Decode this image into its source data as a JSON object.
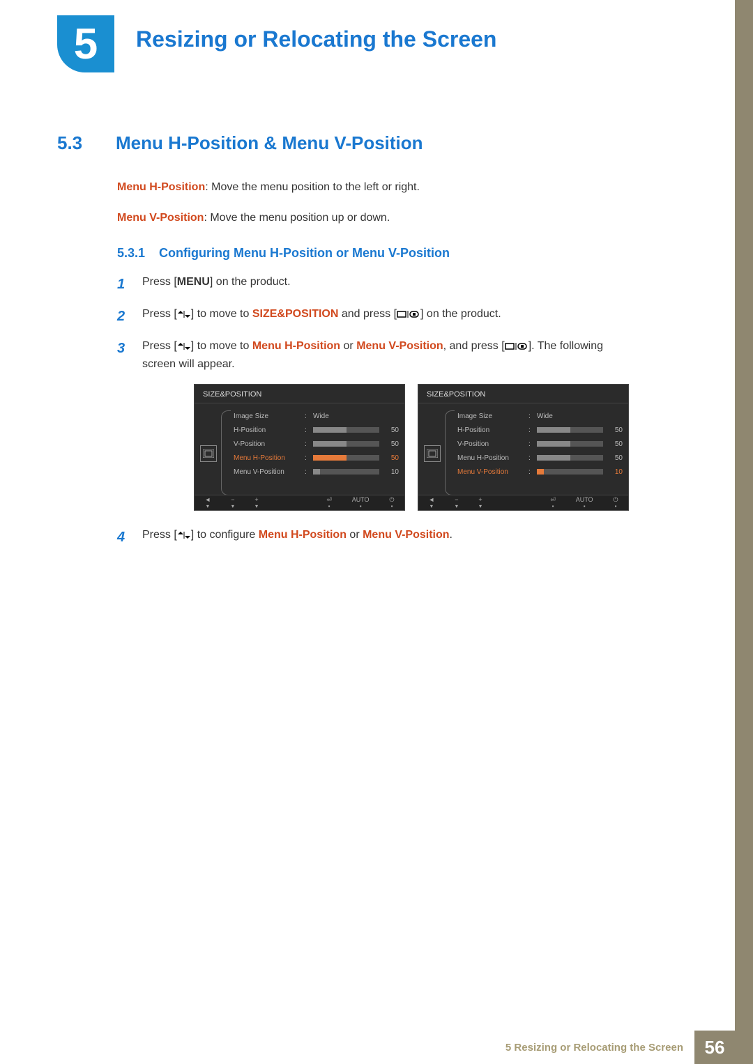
{
  "chapter": {
    "number": "5",
    "title": "Resizing or Relocating the Screen"
  },
  "section": {
    "number": "5.3",
    "title": "Menu H-Position & Menu V-Position"
  },
  "descriptions": {
    "h_label": "Menu H-Position",
    "h_text": ": Move the menu position to the left or right.",
    "v_label": "Menu V-Position",
    "v_text": ": Move the menu position up or down."
  },
  "subsection": {
    "number": "5.3.1",
    "title": "Configuring Menu H-Position or Menu V-Position"
  },
  "steps": {
    "s1": {
      "n": "1",
      "a": "Press [",
      "menu": "MENU",
      "b": "] on the product."
    },
    "s2": {
      "n": "2",
      "a": "Press [",
      "b": "] to move to ",
      "target": "SIZE&POSITION",
      "c": " and press [",
      "d": "] on the product."
    },
    "s3": {
      "n": "3",
      "a": "Press [",
      "b": "] to move to ",
      "t1": "Menu H-Position",
      "or": " or ",
      "t2": "Menu V-Position",
      "c": ", and press [",
      "d": "]. The following screen will appear."
    },
    "s4": {
      "n": "4",
      "a": "Press [",
      "b": "] to configure ",
      "t1": "Menu H-Position",
      "or": " or ",
      "t2": "Menu V-Position",
      "c": "."
    }
  },
  "osd": {
    "title": "SIZE&POSITION",
    "items": {
      "image_size": {
        "label": "Image Size",
        "value": "Wide"
      },
      "h_position": {
        "label": "H-Position",
        "value": "50",
        "percent": 50
      },
      "v_position": {
        "label": "V-Position",
        "value": "50",
        "percent": 50
      },
      "menu_h": {
        "label": "Menu H-Position",
        "value": "50",
        "percent": 50
      },
      "menu_v": {
        "label": "Menu V-Position",
        "value": "10",
        "percent": 10
      }
    },
    "footer": {
      "auto": "AUTO"
    }
  },
  "footer": {
    "text": "5 Resizing or Relocating the Screen",
    "page": "56"
  }
}
